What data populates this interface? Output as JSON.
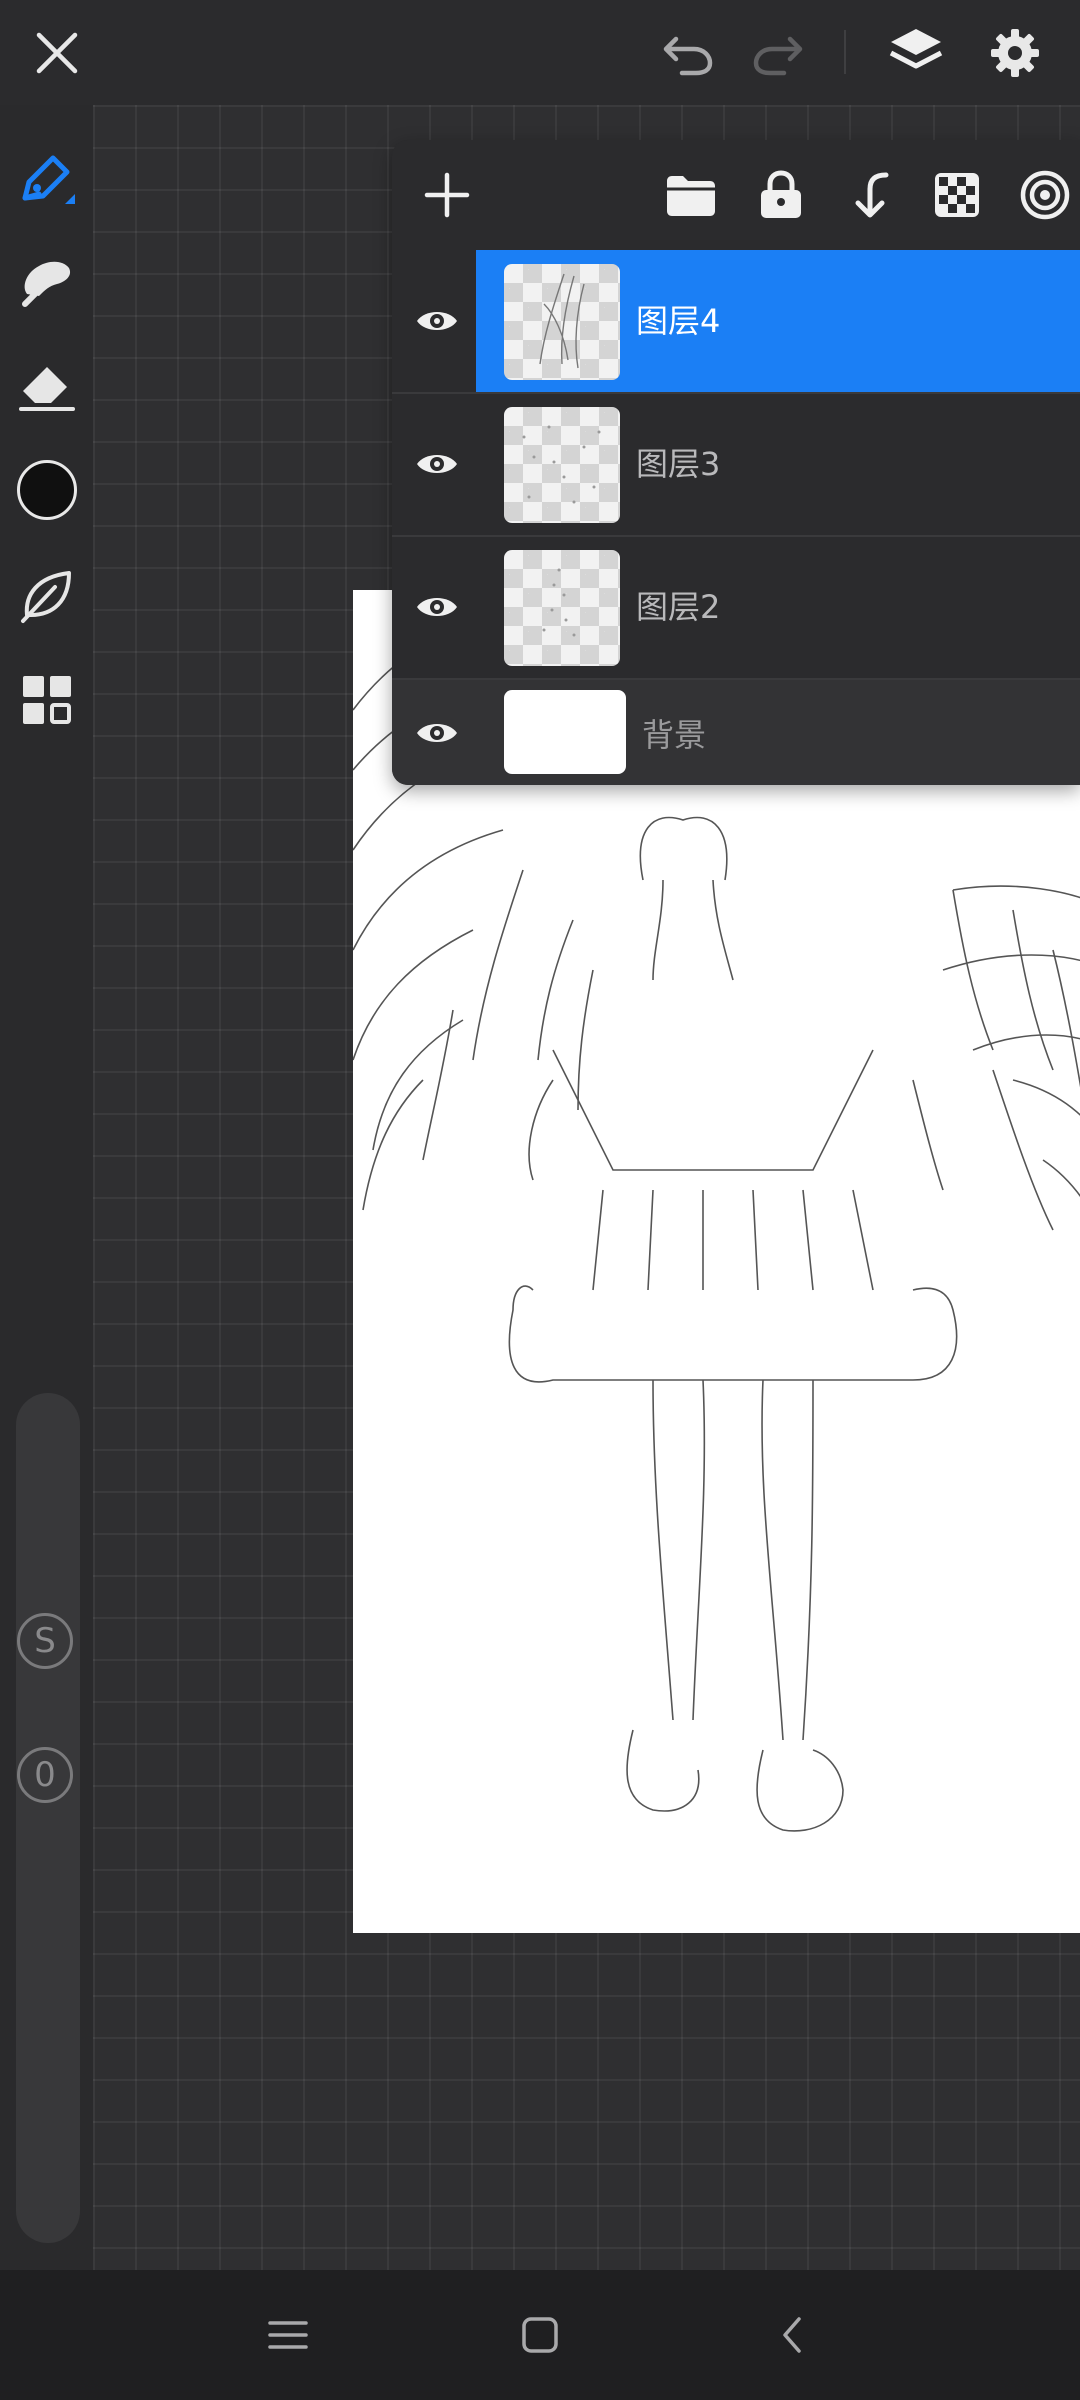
{
  "app": {
    "accent_color": "#1b7ff5",
    "topbar": {
      "close_icon": "close-icon",
      "undo_icon": "undo-icon",
      "redo_icon": "redo-icon",
      "layers_icon": "layers-icon",
      "settings_icon": "gear-icon"
    },
    "left_toolbar": {
      "tools": [
        "brush-icon",
        "smudge-icon",
        "eraser-icon",
        "color-swatch",
        "leaf-icon",
        "gallery-icon"
      ],
      "active_tool": "brush-icon",
      "current_color": "#101010",
      "size_button_label": "S",
      "opacity_button_label": "0"
    },
    "layers_panel": {
      "toolbar_icons": [
        "add-layer-icon",
        "folder-icon",
        "lock-icon",
        "merge-down-icon",
        "transparency-icon",
        "target-icon"
      ],
      "layers": [
        {
          "name": "图层4",
          "visible": true,
          "selected": true
        },
        {
          "name": "图层3",
          "visible": true,
          "selected": false
        },
        {
          "name": "图层2",
          "visible": true,
          "selected": false
        },
        {
          "name": "背景",
          "visible": true,
          "selected": false
        }
      ]
    },
    "navbar": {
      "icons": [
        "menu-icon",
        "home-icon",
        "back-icon"
      ]
    }
  }
}
